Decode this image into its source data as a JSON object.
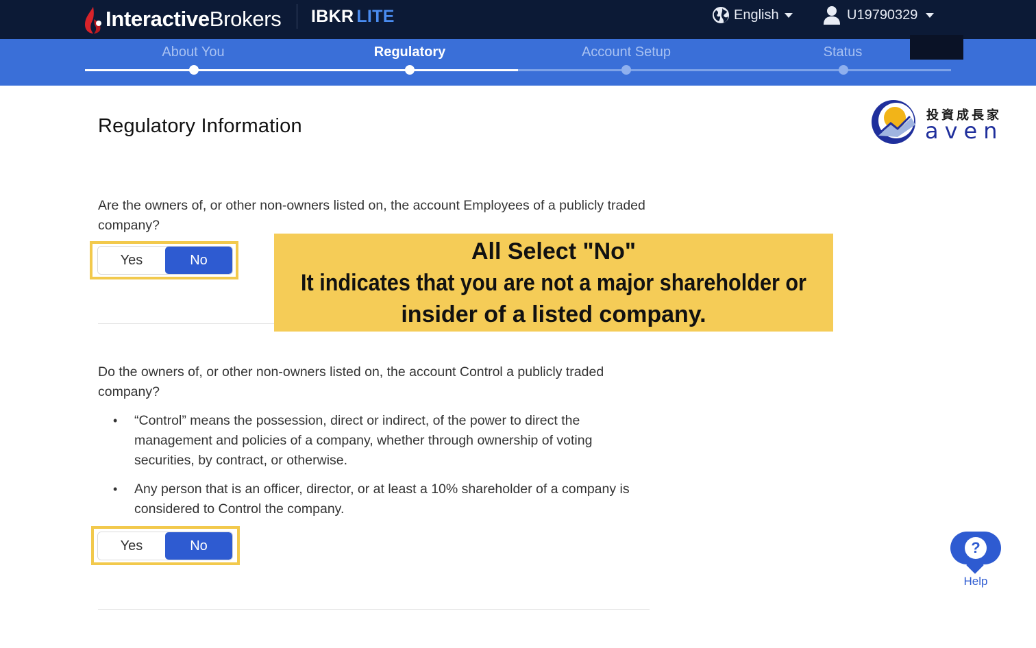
{
  "header": {
    "logo_text_bold": "Interactive",
    "logo_text_light": "Brokers",
    "product": "IBKR",
    "product_tier": "LITE",
    "language": "English",
    "user_id": "U19790329"
  },
  "steps": [
    {
      "label": "About You",
      "state": "done"
    },
    {
      "label": "Regulatory",
      "state": "active"
    },
    {
      "label": "Account Setup",
      "state": "todo"
    },
    {
      "label": "Status",
      "state": "todo"
    }
  ],
  "brand": {
    "cn": "投資成長家",
    "en": "aven"
  },
  "page": {
    "title": "Regulatory Information"
  },
  "question1": {
    "text": "Are the owners of, or other non-owners listed on, the account Employees of a publicly traded company?",
    "yes_label": "Yes",
    "no_label": "No",
    "selected": "No"
  },
  "question2": {
    "text": "Do the owners of, or other non-owners listed on, the account Control a publicly traded company?",
    "bullets": [
      "“Control” means the possession, direct or indirect, of the power to direct the management and policies of a company, whether through ownership of voting securities, by contract, or otherwise.",
      "Any person that is an officer, director, or at least a 10% shareholder of a company is considered to Control the company."
    ],
    "yes_label": "Yes",
    "no_label": "No",
    "selected": "No"
  },
  "annotation": {
    "line1": "All Select \"No\"",
    "line2": "It indicates that you are not a major shareholder or",
    "line3": "insider of a listed company."
  },
  "help": {
    "label": "Help"
  },
  "colors": {
    "topbar": "#0c1a36",
    "stepbar": "#3a6fd8",
    "accent": "#2e5bd1",
    "highlight": "#f2c94c",
    "annotation_bg": "#f5cc57"
  }
}
